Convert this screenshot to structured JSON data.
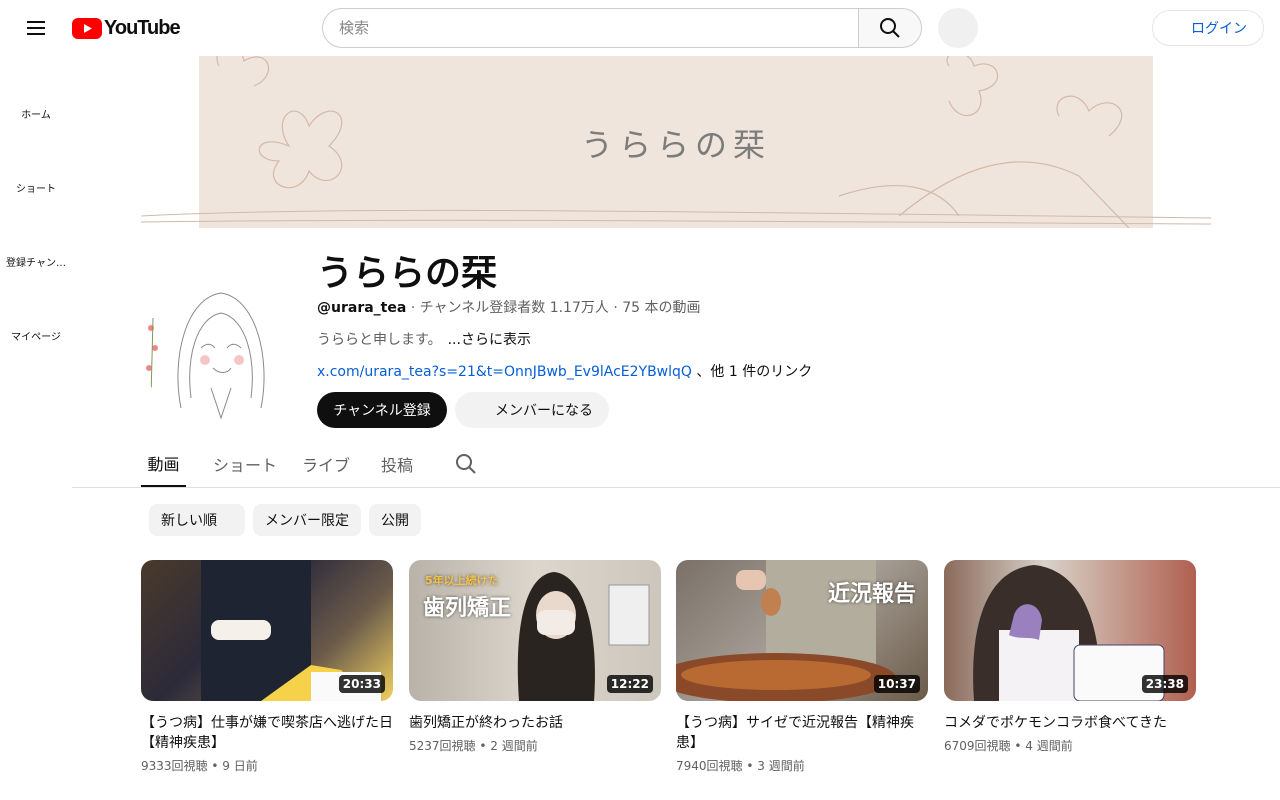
{
  "header": {
    "logo_text": "YouTube",
    "search_placeholder": "検索",
    "login_label": "ログイン"
  },
  "sidebar": {
    "items": [
      {
        "label": "ホーム"
      },
      {
        "label": "ショート"
      },
      {
        "label": "登録チャン…"
      },
      {
        "label": "マイページ"
      }
    ]
  },
  "banner": {
    "title": "うららの栞"
  },
  "channel": {
    "name": "うららの栞",
    "handle": "@urara_tea",
    "stats": " · チャンネル登録者数 1.17万人 · 75 本の動画",
    "description": "うららと申します。",
    "more_label": "...さらに表示",
    "link_url": "x.com/urara_tea?s=21&t=OnnJBwb_Ev9lAcE2YBwlqQ",
    "link_others": " 、他 1 件のリンク",
    "subscribe_label": "チャンネル登録",
    "member_label": "メンバーになる"
  },
  "tabs": [
    {
      "label": "動画"
    },
    {
      "label": "ショート"
    },
    {
      "label": "ライブ"
    },
    {
      "label": "投稿"
    }
  ],
  "chips": [
    {
      "label": "新しい順"
    },
    {
      "label": "メンバー限定"
    },
    {
      "label": "公開"
    }
  ],
  "videos": [
    {
      "title": "【うつ病】仕事が嫌で喫茶店へ逃げた日【精神疾患】",
      "meta": "9333回視聴 • 9 日前",
      "duration": "20:33",
      "overlay": ""
    },
    {
      "title": "歯列矯正が終わったお話",
      "meta": "5237回視聴 • 2 週間前",
      "duration": "12:22",
      "overlay": "歯列矯正",
      "overlay_small": "5年以上続けた"
    },
    {
      "title": "【うつ病】サイゼで近況報告【精神疾患】",
      "meta": "7940回視聴 • 3 週間前",
      "duration": "10:37",
      "overlay": "近況報告"
    },
    {
      "title": "コメダでポケモンコラボ食べてきた",
      "meta": "6709回視聴 • 4 週間前",
      "duration": "23:38",
      "overlay": ""
    }
  ]
}
